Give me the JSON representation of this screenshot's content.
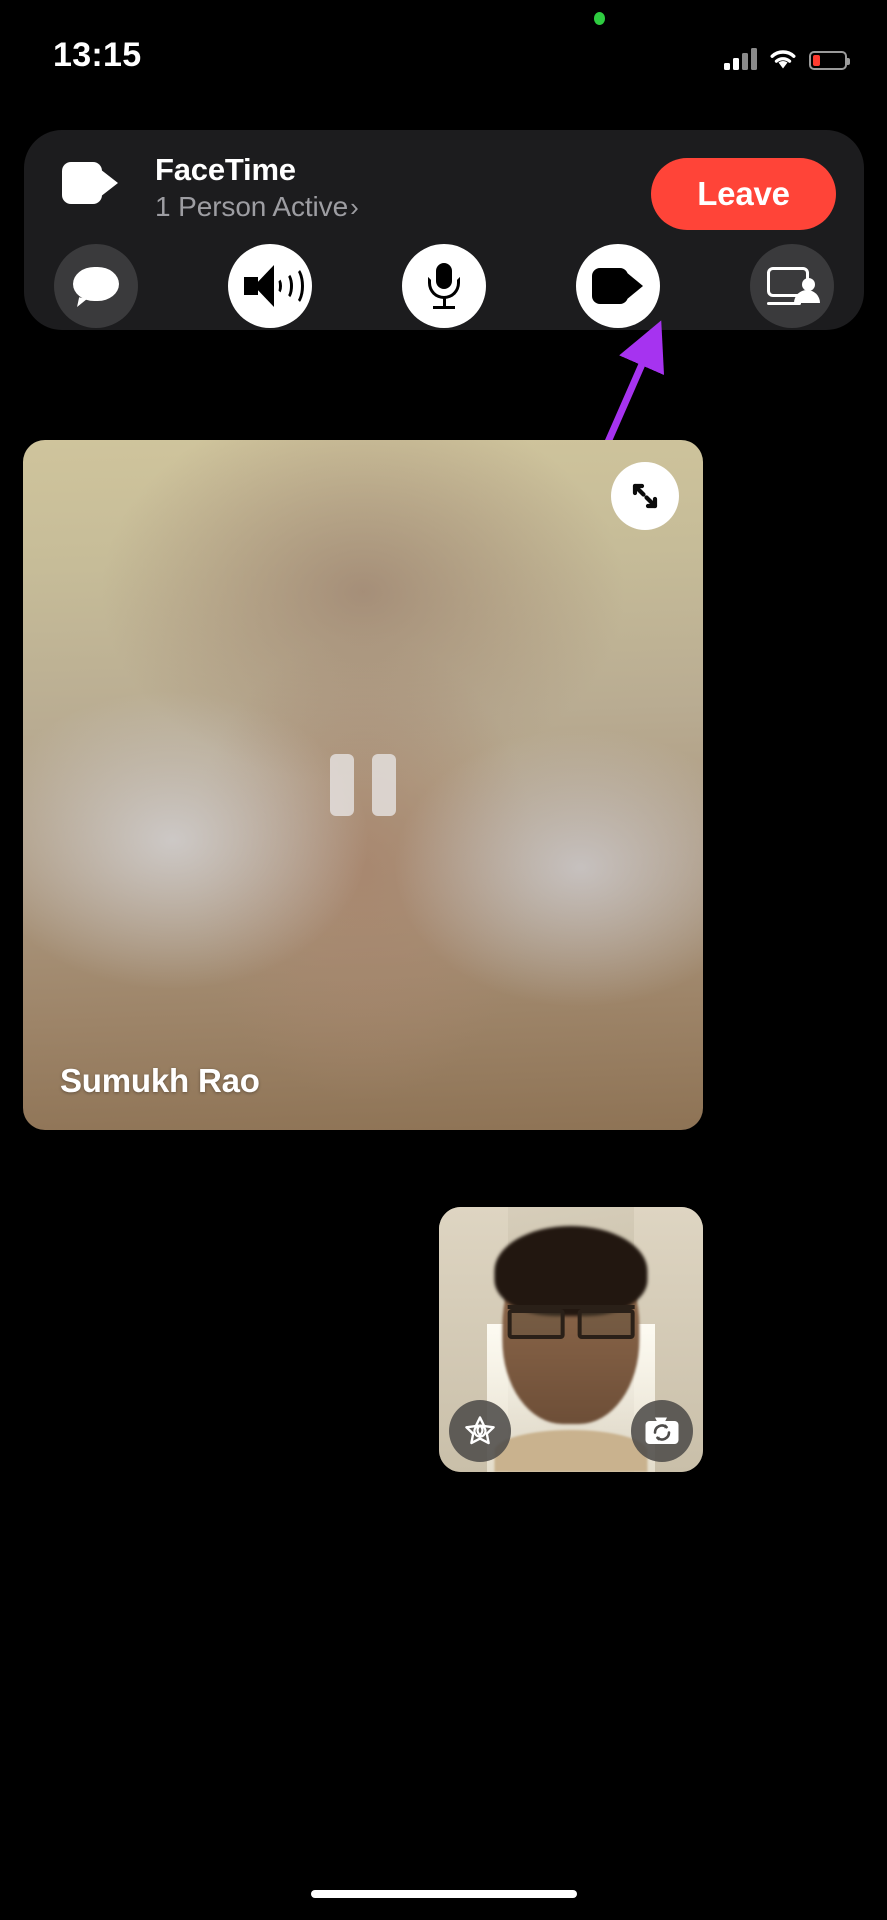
{
  "status_bar": {
    "time": "13:15",
    "camera_indicator": "green-dot",
    "cellular_icon": "cellular-bars-icon",
    "wifi_icon": "wifi-icon",
    "battery_icon": "battery-low-icon",
    "battery_color": "#ff3b30"
  },
  "call_banner": {
    "app_icon": "facetime-video-icon",
    "title": "FaceTime",
    "subtitle": "1 Person Active",
    "subtitle_chevron": "›",
    "leave_label": "Leave",
    "leave_color": "#ff4438",
    "background_color": "#1c1c1e"
  },
  "controls": [
    {
      "name": "messages-button",
      "icon": "message-bubble-icon",
      "state": "inactive",
      "background": "#3a3a3c"
    },
    {
      "name": "speaker-button",
      "icon": "speaker-wave-icon",
      "state": "active",
      "background": "#ffffff"
    },
    {
      "name": "microphone-button",
      "icon": "microphone-icon",
      "state": "active",
      "background": "#ffffff"
    },
    {
      "name": "video-button",
      "icon": "video-camera-icon",
      "state": "active",
      "background": "#ffffff"
    },
    {
      "name": "shareplay-button",
      "icon": "screen-share-person-icon",
      "state": "inactive",
      "background": "#3a3a3c"
    }
  ],
  "annotation": {
    "type": "arrow",
    "color": "#a633f0",
    "points_to": "shareplay-button"
  },
  "main_video": {
    "participant_name": "Sumukh Rao",
    "state_icon": "pause-icon",
    "expand_icon": "expand-diagonal-arrows-icon"
  },
  "self_view": {
    "effects_icon": "effects-star-icon",
    "flip_camera_icon": "camera-flip-icon"
  },
  "home_indicator": "home-indicator-bar"
}
